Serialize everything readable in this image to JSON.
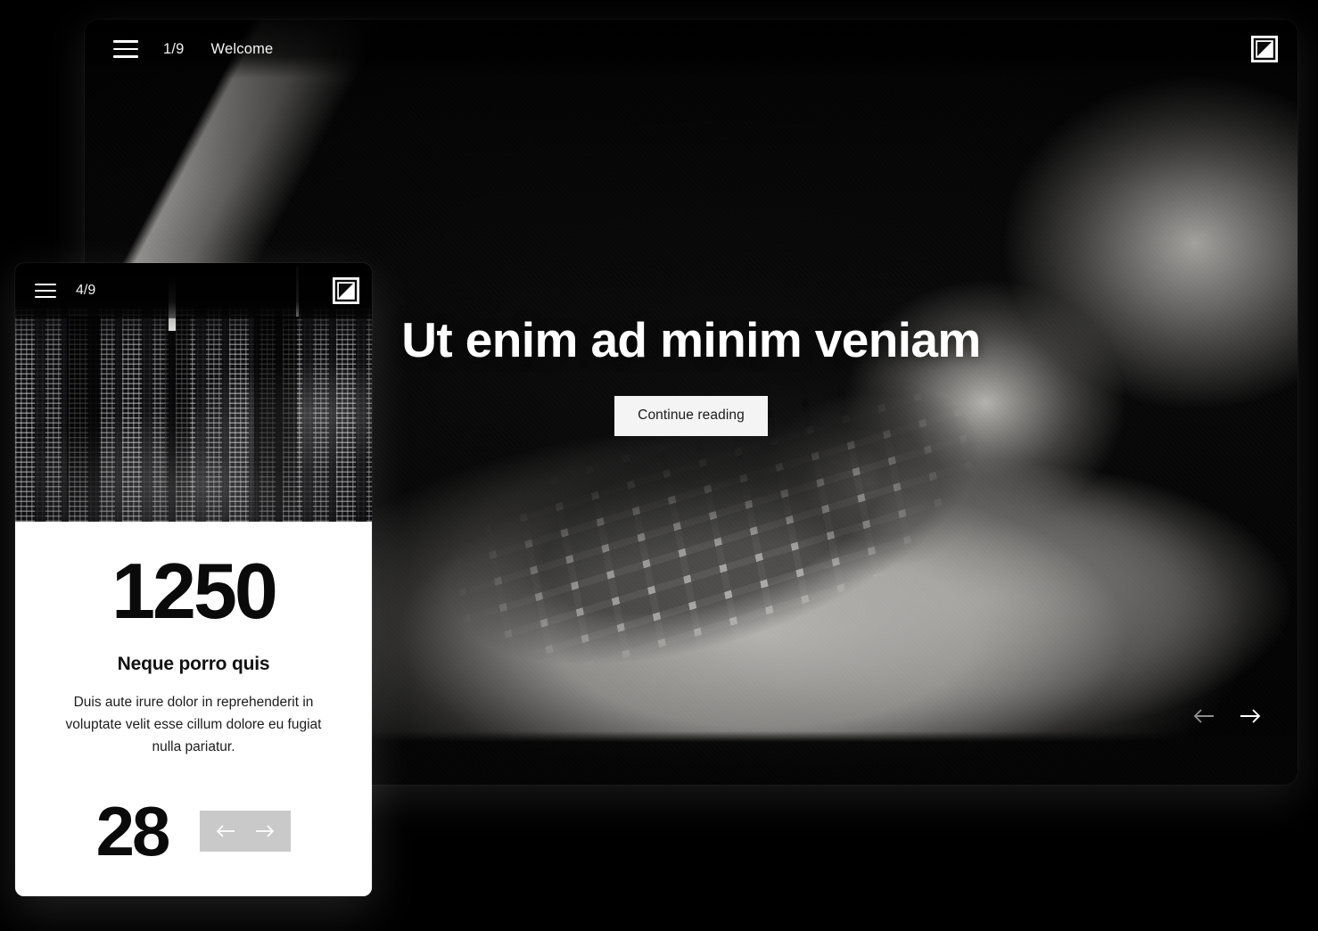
{
  "desktop": {
    "topbar": {
      "menu_icon": "hamburger-menu-icon",
      "slide_counter": "1/9",
      "slide_title": "Welcome",
      "logo_icon": "brand-logo-icon"
    },
    "hero": {
      "heading": "Ut enim ad minim veniam",
      "cta_label": "Continue reading",
      "background_image": "black-and-white-photo-hands-typing-on-laptop"
    },
    "nav": {
      "prev_icon": "arrow-left-icon",
      "next_icon": "arrow-right-icon",
      "prev_color": "#8a8a8a",
      "next_color": "#ffffff"
    }
  },
  "mobile": {
    "topbar": {
      "menu_icon": "hamburger-menu-icon",
      "slide_counter": "4/9",
      "logo_icon": "brand-logo-icon"
    },
    "photo": {
      "image": "black-and-white-night-city-skyline"
    },
    "stat": {
      "value": "1250",
      "label": "Neque porro quis",
      "body": "Duis aute irure dolor in reprehenderit in voluptate velit esse cillum dolore eu fugiat nulla pariatur."
    },
    "footer": {
      "secondary_value": "28",
      "nav_background": "#c9c9c9",
      "prev_icon": "arrow-left-icon",
      "next_icon": "arrow-right-icon"
    }
  },
  "theme": {
    "page_background": "#000000",
    "surface_dark": "#050505",
    "surface_light": "#ffffff",
    "text_on_dark": "#ffffff",
    "text_on_light": "#0a0a0a",
    "cta_background": "#f4f4f4"
  }
}
